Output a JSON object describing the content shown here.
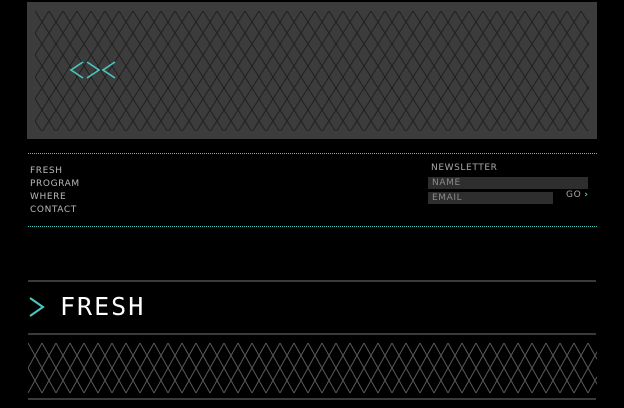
{
  "brand": {
    "logo_text": "<><",
    "accent_color": "#4bc8c0"
  },
  "nav": {
    "items": [
      "FRESH",
      "PROGRAM",
      "WHERE",
      "CONTACT"
    ]
  },
  "newsletter": {
    "label": "NEWSLETTER",
    "name_placeholder": "NAME",
    "email_placeholder": "EMAIL",
    "submit_label": "GO"
  },
  "section": {
    "title": "FRESH"
  }
}
